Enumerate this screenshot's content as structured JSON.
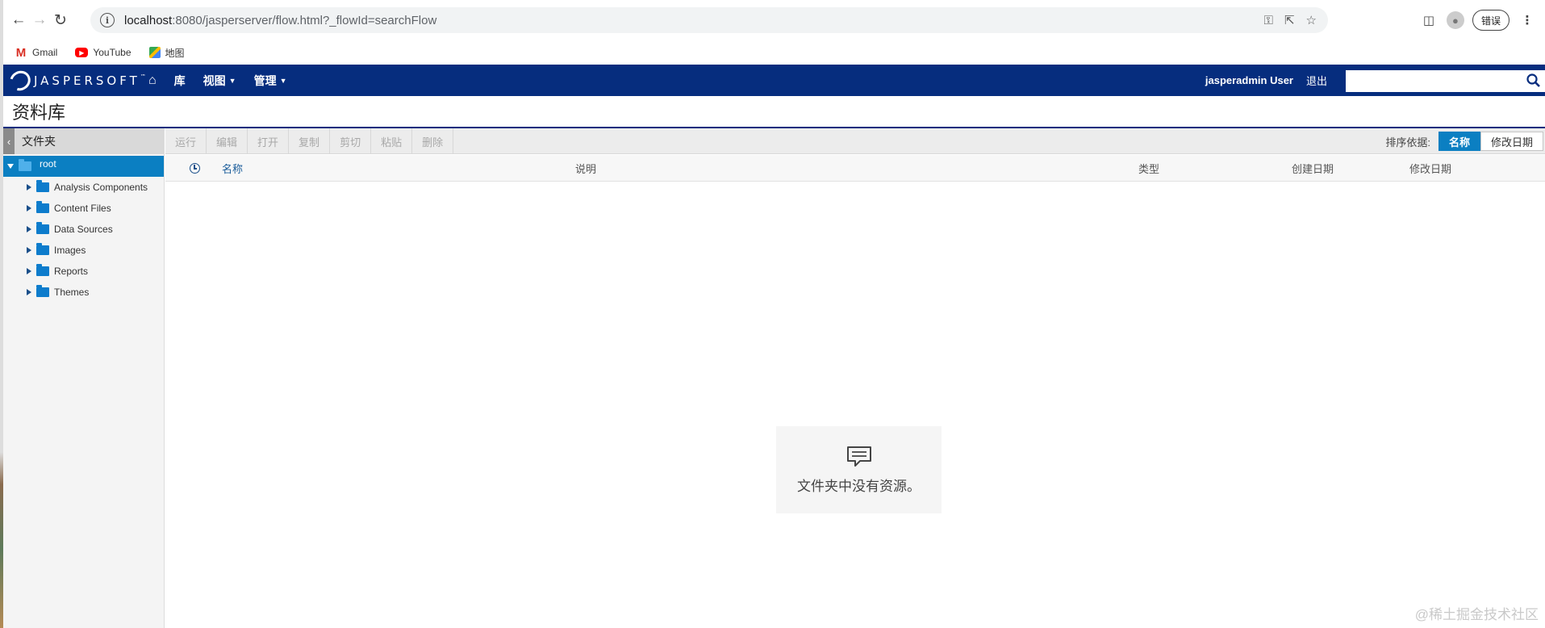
{
  "browser": {
    "url_host": "localhost",
    "url_rest": ":8080/jasperserver/flow.html?_flowId=searchFlow",
    "error_button": "错误",
    "bookmarks": [
      {
        "label": "Gmail",
        "icon": "gmail-icon"
      },
      {
        "label": "YouTube",
        "icon": "youtube-icon"
      },
      {
        "label": "地图",
        "icon": "maps-icon"
      }
    ]
  },
  "app": {
    "logo_text": "JASPERSOFT",
    "logo_tm": "™",
    "nav": {
      "library": "库",
      "view": "视图",
      "manage": "管理"
    },
    "user": "jasperadmin User",
    "logout": "退出"
  },
  "page": {
    "title": "资料库"
  },
  "left_panel": {
    "title": "文件夹",
    "root": "root",
    "folders": [
      "Analysis Components",
      "Content Files",
      "Data Sources",
      "Images",
      "Reports",
      "Themes"
    ]
  },
  "toolbar": {
    "actions": [
      "运行",
      "编辑",
      "打开",
      "复制",
      "剪切",
      "粘贴",
      "删除"
    ],
    "sort_label": "排序依据:",
    "sort_name": "名称",
    "sort_modified": "修改日期"
  },
  "columns": {
    "name": "名称",
    "description": "说明",
    "type": "类型",
    "created": "创建日期",
    "modified": "修改日期"
  },
  "empty_message": "文件夹中没有资源。",
  "watermark": "@稀土掘金技术社区",
  "colors": {
    "topbar": "#062d7e",
    "accent": "#0b7fc2"
  }
}
